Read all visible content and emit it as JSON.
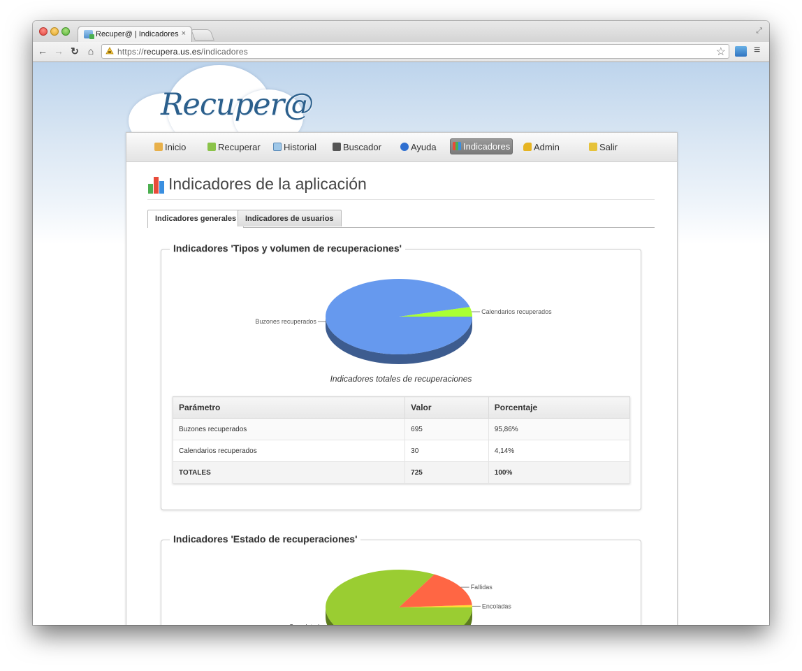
{
  "browser": {
    "tab_title": "Recuper@ | Indicadores",
    "tab_close": "×",
    "url_scheme": "https://",
    "url_host": "recupera.us.es",
    "url_path": "/indicadores"
  },
  "site": {
    "logo": "Recuper@",
    "menu": [
      {
        "label": "Inicio",
        "icon": "home-icon"
      },
      {
        "label": "Recuperar",
        "icon": "recover-icon"
      },
      {
        "label": "Historial",
        "icon": "history-icon"
      },
      {
        "label": "Buscador",
        "icon": "binoculars-icon"
      },
      {
        "label": "Ayuda",
        "icon": "help-icon"
      },
      {
        "label": "Indicadores",
        "icon": "bar-chart-icon",
        "active": true
      },
      {
        "label": "Admin",
        "icon": "key-icon"
      },
      {
        "label": "Salir",
        "icon": "logout-icon"
      }
    ]
  },
  "page": {
    "title": "Indicadores de la aplicación",
    "tabs": [
      {
        "label": "Indicadores generales",
        "active": true
      },
      {
        "label": "Indicadores de usuarios",
        "active": false
      }
    ]
  },
  "section1": {
    "legend": "Indicadores 'Tipos y volumen de recuperaciones'",
    "table": {
      "headers": [
        "Parámetro",
        "Valor",
        "Porcentaje"
      ],
      "rows": [
        [
          "Buzones recuperados",
          "695",
          "95,86%"
        ],
        [
          "Calendarios recuperados",
          "30",
          "4,14%"
        ],
        [
          "TOTALES",
          "725",
          "100%"
        ]
      ]
    }
  },
  "section2": {
    "legend": "Indicadores 'Estado de recuperaciones'"
  },
  "chart_data": [
    {
      "type": "pie",
      "title": "Indicadores totales de recuperaciones",
      "labels": [
        "Buzones recuperados",
        "Calendarios recuperados"
      ],
      "values": [
        695,
        30
      ],
      "colors": [
        "#6699ee",
        "#aaff33"
      ]
    },
    {
      "type": "pie",
      "title": "",
      "labels": [
        "Completadas",
        "Fallidas",
        "Encoladas"
      ],
      "values": [
        83,
        16,
        1
      ],
      "colors": [
        "#9acd32",
        "#ff6644",
        "#ffdd33"
      ]
    }
  ]
}
